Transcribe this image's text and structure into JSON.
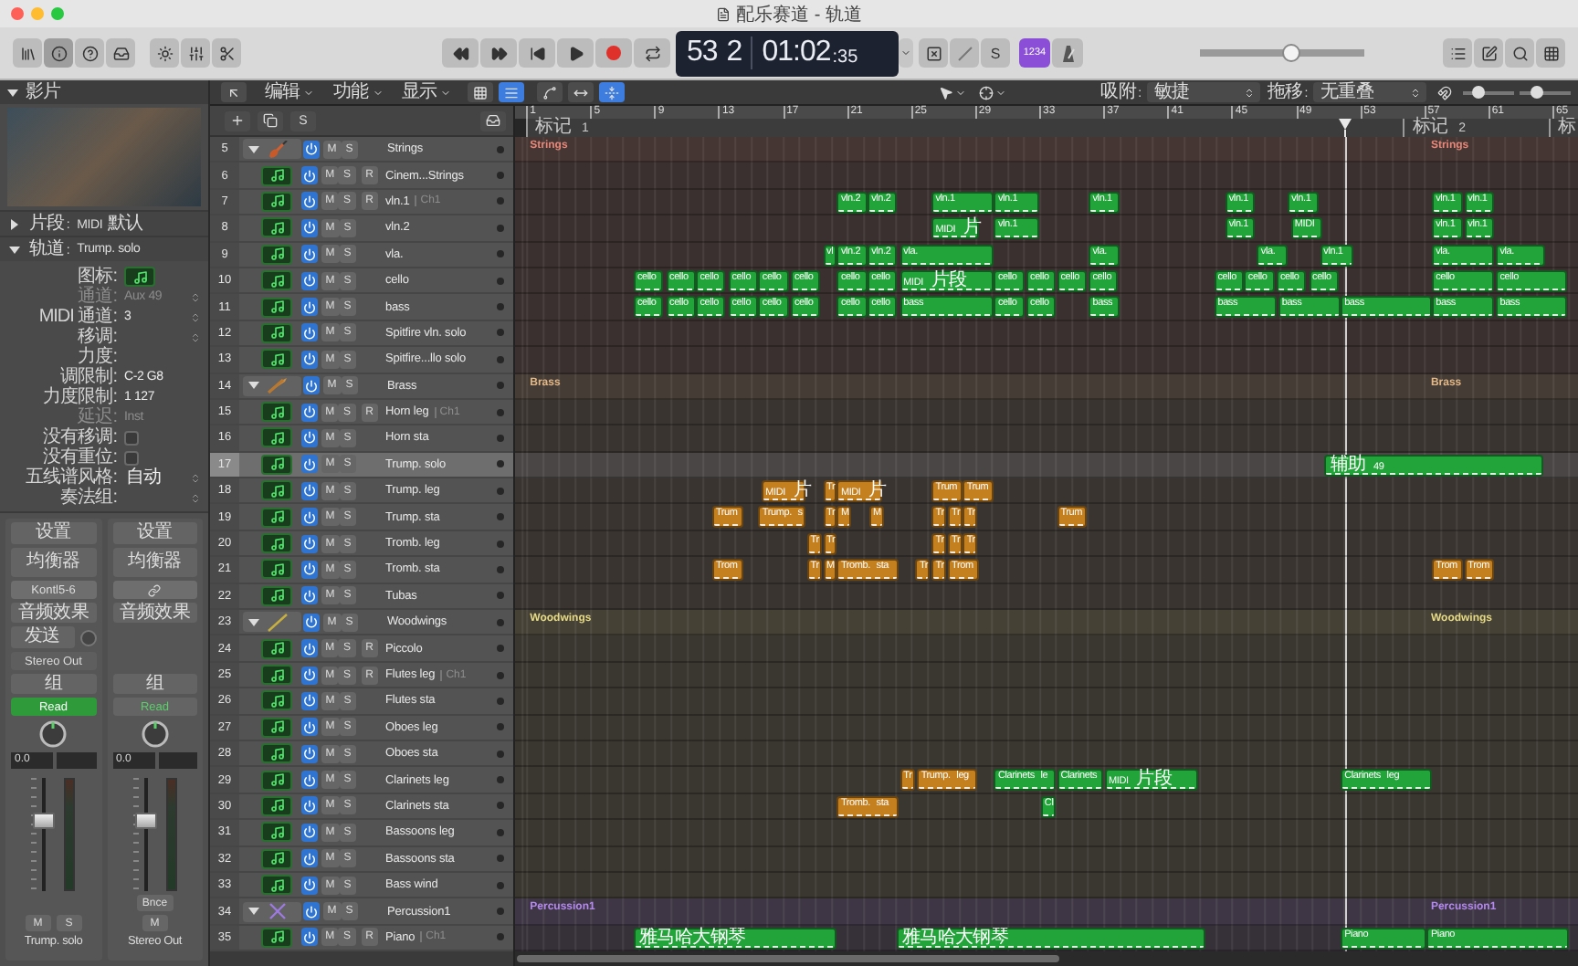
{
  "window": {
    "title": "配乐赛道 - 轨道"
  },
  "toolbar": {
    "lcd": {
      "bar": "53",
      "beat": "2",
      "time": "01:02",
      "time_fraction": ":35"
    },
    "solo_key": "S",
    "count_in": {
      "label": "1234",
      "on": true
    },
    "master_volume": {
      "level": 0.55
    }
  },
  "edit_bar": {
    "menus": [
      "编辑",
      "功能",
      "显示"
    ],
    "view_toggle": [
      {
        "selected": false
      },
      {
        "selected": true
      }
    ],
    "catch": {
      "on": true
    },
    "snap": {
      "label": "吸附:",
      "value": "敏捷"
    },
    "drag": {
      "label": "拖移:",
      "value": "无重叠"
    },
    "zoom": [
      {
        "level": 0.3
      },
      {
        "level": 0.35
      }
    ]
  },
  "track_header": {
    "solo_key": "S"
  },
  "inspector": {
    "title": "影片",
    "region": {
      "label": "片段:",
      "value": "MIDI 默认",
      "expanded": false
    },
    "track": {
      "label": "轨道:",
      "value": "Trump. solo",
      "expanded": true
    },
    "params": [
      {
        "kind": "icon",
        "label": "图标:"
      },
      {
        "kind": "menu",
        "label": "通道:",
        "value": "Aux 49",
        "disabled": true
      },
      {
        "kind": "menu",
        "label": "MIDI 通道:",
        "value": "3",
        "disabled": false
      },
      {
        "kind": "menu",
        "label": "移调:",
        "disabled": false
      },
      {
        "kind": "text",
        "label": "力度:",
        "disabled": false
      },
      {
        "kind": "text",
        "label": "调限制:",
        "value": "C-2 G8",
        "disabled": false
      },
      {
        "kind": "text",
        "label": "力度限制:",
        "value": "1 127",
        "disabled": false
      },
      {
        "kind": "text",
        "label": "延迟:",
        "value": "Inst",
        "disabled": true
      },
      {
        "kind": "checkbox",
        "label": "没有移调:",
        "checked": false
      },
      {
        "kind": "checkbox",
        "label": "没有重位:",
        "checked": false
      },
      {
        "kind": "menu",
        "label": "五线谱风格:",
        "value": "自动",
        "disabled": false
      },
      {
        "kind": "menu",
        "label": "奏法组:",
        "disabled": false
      }
    ],
    "strips": [
      {
        "setting": "设置",
        "eq": "均衡器",
        "slot": {
          "kind": "text",
          "label": "Kontl5-6"
        },
        "effects": "音频效果",
        "send": "发送",
        "output": "Stereo Out",
        "group": "组",
        "automation": {
          "label": "Read",
          "on": true
        },
        "pan": "0.0",
        "fader": {
          "level": 0.62
        },
        "buttons": [
          "M",
          "S"
        ],
        "name": "Trump. solo"
      },
      {
        "setting": "设置",
        "eq": "均衡器",
        "slot": {
          "kind": "link"
        },
        "effects": "音频效果",
        "group": "组",
        "automation": {
          "label": "Read",
          "on": false
        },
        "pan": "0.0",
        "fader": {
          "level": 0.62
        },
        "bounce": "Bnce",
        "buttons": [
          "M"
        ],
        "name": "Stereo Out"
      }
    ]
  },
  "ruler": {
    "bars": [
      "1",
      "5",
      "9",
      "13",
      "17",
      "21",
      "25",
      "29",
      "33",
      "37",
      "41",
      "45",
      "49",
      "53",
      "57",
      "61",
      "65"
    ],
    "markers": [
      "标记 1",
      "标记 2",
      "标"
    ]
  },
  "tracks": [
    {
      "number": "5",
      "kind": "folder",
      "name": "Strings",
      "expanded": true,
      "color": "#e7887a",
      "buttons": [
        "M",
        "S"
      ],
      "selected": false,
      "labels": [
        "Strings",
        "Strings"
      ]
    },
    {
      "number": "6",
      "kind": "track",
      "name": "Cinem...Strings",
      "buttons": [
        "M",
        "S",
        "R"
      ],
      "selected": false
    },
    {
      "number": "7",
      "kind": "track",
      "name": "vln.1",
      "tag": "Ch1",
      "buttons": [
        "M",
        "S",
        "R"
      ],
      "selected": false,
      "regions": [
        {
          "label": "vln.2",
          "color": "#22a43a"
        },
        {
          "label": "vln.2",
          "color": "#22a43a"
        },
        {
          "label": "vln.1",
          "color": "#22a43a"
        },
        {
          "label": "vln.1",
          "color": "#22a43a"
        },
        {
          "label": "vln.1",
          "color": "#22a43a"
        },
        {
          "label": "vln.1",
          "color": "#22a43a"
        },
        {
          "label": "vln.1",
          "color": "#22a43a"
        },
        {
          "label": "vln.1",
          "color": "#22a43a"
        },
        {
          "label": "vln.1",
          "color": "#22a43a"
        }
      ]
    },
    {
      "number": "8",
      "kind": "track",
      "name": "vln.2",
      "buttons": [
        "M",
        "S"
      ],
      "selected": false,
      "regions": [
        {
          "label": "MIDI 片",
          "color": "#22a43a"
        },
        {
          "label": "vln.1",
          "color": "#22a43a"
        },
        {
          "label": "vln.1",
          "color": "#22a43a"
        },
        {
          "label": "MIDI",
          "color": "#22a43a"
        },
        {
          "label": "vln.1",
          "color": "#22a43a"
        },
        {
          "label": "vln.1",
          "color": "#22a43a"
        }
      ]
    },
    {
      "number": "9",
      "kind": "track",
      "name": "vla.",
      "buttons": [
        "M",
        "S"
      ],
      "selected": false,
      "regions": [
        {
          "label": "vl",
          "color": "#22a43a"
        },
        {
          "label": "vln.2",
          "color": "#22a43a"
        },
        {
          "label": "vln.2",
          "color": "#22a43a"
        },
        {
          "label": "vla.",
          "color": "#22a43a"
        },
        {
          "label": "vla.",
          "color": "#22a43a"
        },
        {
          "label": "vla.",
          "color": "#22a43a"
        },
        {
          "label": "vln.1",
          "color": "#22a43a"
        },
        {
          "label": "vla.",
          "color": "#22a43a"
        },
        {
          "label": "vla.",
          "color": "#22a43a"
        }
      ]
    },
    {
      "number": "10",
      "kind": "track",
      "name": "cello",
      "buttons": [
        "M",
        "S"
      ],
      "selected": false,
      "regions": [
        {
          "label": "cello",
          "color": "#22a43a"
        },
        {
          "label": "cello",
          "color": "#22a43a"
        },
        {
          "label": "cello",
          "color": "#22a43a"
        },
        {
          "label": "cello",
          "color": "#22a43a"
        },
        {
          "label": "cello",
          "color": "#22a43a"
        },
        {
          "label": "cello",
          "color": "#22a43a"
        },
        {
          "label": "cello",
          "color": "#22a43a"
        },
        {
          "label": "cello",
          "color": "#22a43a"
        },
        {
          "label": "MIDI 片段",
          "color": "#22a43a"
        },
        {
          "label": "cello",
          "color": "#22a43a"
        },
        {
          "label": "cello",
          "color": "#22a43a"
        },
        {
          "label": "cello",
          "color": "#22a43a"
        },
        {
          "label": "cello",
          "color": "#22a43a"
        },
        {
          "label": "cello",
          "color": "#22a43a"
        },
        {
          "label": "cello",
          "color": "#22a43a"
        },
        {
          "label": "cello",
          "color": "#22a43a"
        },
        {
          "label": "cello",
          "color": "#22a43a"
        },
        {
          "label": "cello",
          "color": "#22a43a"
        },
        {
          "label": "cello",
          "color": "#22a43a"
        }
      ]
    },
    {
      "number": "11",
      "kind": "track",
      "name": "bass",
      "buttons": [
        "M",
        "S"
      ],
      "selected": false,
      "regions": [
        {
          "label": "cello",
          "color": "#22a43a"
        },
        {
          "label": "cello",
          "color": "#22a43a"
        },
        {
          "label": "cello",
          "color": "#22a43a"
        },
        {
          "label": "cello",
          "color": "#22a43a"
        },
        {
          "label": "cello",
          "color": "#22a43a"
        },
        {
          "label": "cello",
          "color": "#22a43a"
        },
        {
          "label": "cello",
          "color": "#22a43a"
        },
        {
          "label": "cello",
          "color": "#22a43a"
        },
        {
          "label": "bass",
          "color": "#22a43a"
        },
        {
          "label": "cello",
          "color": "#22a43a"
        },
        {
          "label": "cello",
          "color": "#22a43a"
        },
        {
          "label": "bass",
          "color": "#22a43a"
        },
        {
          "label": "bass",
          "color": "#22a43a"
        },
        {
          "label": "bass",
          "color": "#22a43a"
        },
        {
          "label": "bass",
          "color": "#22a43a"
        },
        {
          "label": "bass",
          "color": "#22a43a"
        },
        {
          "label": "bass",
          "color": "#22a43a"
        }
      ]
    },
    {
      "number": "12",
      "kind": "track",
      "name": "Spitfire vln. solo",
      "buttons": [
        "M",
        "S"
      ],
      "selected": false
    },
    {
      "number": "13",
      "kind": "track",
      "name": "Spitfire...llo solo",
      "buttons": [
        "M",
        "S"
      ],
      "selected": false
    },
    {
      "number": "14",
      "kind": "folder",
      "name": "Brass",
      "expanded": true,
      "color": "#e2b888",
      "buttons": [
        "M",
        "S"
      ],
      "selected": false,
      "labels": [
        "Brass",
        "Brass"
      ]
    },
    {
      "number": "15",
      "kind": "track",
      "name": "Horn leg",
      "tag": "Ch1",
      "buttons": [
        "M",
        "S",
        "R"
      ],
      "selected": false
    },
    {
      "number": "16",
      "kind": "track",
      "name": "Horn sta",
      "buttons": [
        "M",
        "S"
      ],
      "selected": false
    },
    {
      "number": "17",
      "kind": "track",
      "name": "Trump. solo",
      "buttons": [
        "M",
        "S"
      ],
      "selected": true,
      "regions": [
        {
          "label": "辅助 49",
          "color": "#22a43a"
        }
      ]
    },
    {
      "number": "18",
      "kind": "track",
      "name": "Trump. leg",
      "buttons": [
        "M",
        "S"
      ],
      "selected": false,
      "regions": [
        {
          "label": "MIDI 片",
          "color": "#c47f1f"
        },
        {
          "label": "Tr",
          "color": "#c47f1f"
        },
        {
          "label": "MIDI 片",
          "color": "#c47f1f"
        },
        {
          "label": "Trum",
          "color": "#c47f1f"
        },
        {
          "label": "Trum",
          "color": "#c47f1f"
        }
      ]
    },
    {
      "number": "19",
      "kind": "track",
      "name": "Trump. sta",
      "buttons": [
        "M",
        "S"
      ],
      "selected": false,
      "regions": [
        {
          "label": "Trum",
          "color": "#c47f1f"
        },
        {
          "label": "Trump. s",
          "color": "#c47f1f"
        },
        {
          "label": "Tr",
          "color": "#c47f1f"
        },
        {
          "label": "M",
          "color": "#c47f1f"
        },
        {
          "label": "M",
          "color": "#c47f1f"
        },
        {
          "label": "Tr",
          "color": "#c47f1f"
        },
        {
          "label": "Tr",
          "color": "#c47f1f"
        },
        {
          "label": "Tr",
          "color": "#c47f1f"
        },
        {
          "label": "Trum",
          "color": "#c47f1f"
        }
      ]
    },
    {
      "number": "20",
      "kind": "track",
      "name": "Tromb. leg",
      "buttons": [
        "M",
        "S"
      ],
      "selected": false,
      "regions": [
        {
          "label": "Tr",
          "color": "#c47f1f"
        },
        {
          "label": "Tr",
          "color": "#c47f1f"
        },
        {
          "label": "Tr",
          "color": "#c47f1f"
        },
        {
          "label": "Tr",
          "color": "#c47f1f"
        },
        {
          "label": "Tr",
          "color": "#c47f1f"
        }
      ]
    },
    {
      "number": "21",
      "kind": "track",
      "name": "Tromb. sta",
      "buttons": [
        "M",
        "S"
      ],
      "selected": false,
      "regions": [
        {
          "label": "Trom",
          "color": "#c47f1f"
        },
        {
          "label": "Tr",
          "color": "#c47f1f"
        },
        {
          "label": "M",
          "color": "#c47f1f"
        },
        {
          "label": "Tromb. sta",
          "color": "#c47f1f"
        },
        {
          "label": "Tr",
          "color": "#c47f1f"
        },
        {
          "label": "Tr",
          "color": "#c47f1f"
        },
        {
          "label": "Trom",
          "color": "#c47f1f"
        },
        {
          "label": "Trom",
          "color": "#c47f1f"
        },
        {
          "label": "Trom",
          "color": "#c47f1f"
        }
      ]
    },
    {
      "number": "22",
      "kind": "track",
      "name": "Tubas",
      "buttons": [
        "M",
        "S"
      ],
      "selected": false
    },
    {
      "number": "23",
      "kind": "folder",
      "name": "Woodwings",
      "expanded": true,
      "color": "#e6da86",
      "buttons": [
        "M",
        "S"
      ],
      "selected": false,
      "labels": [
        "Woodwings",
        "Woodwings"
      ]
    },
    {
      "number": "24",
      "kind": "track",
      "name": "Piccolo",
      "buttons": [
        "M",
        "S",
        "R"
      ],
      "selected": false
    },
    {
      "number": "25",
      "kind": "track",
      "name": "Flutes leg",
      "tag": "Ch1",
      "buttons": [
        "M",
        "S",
        "R"
      ],
      "selected": false
    },
    {
      "number": "26",
      "kind": "track",
      "name": "Flutes sta",
      "buttons": [
        "M",
        "S"
      ],
      "selected": false
    },
    {
      "number": "27",
      "kind": "track",
      "name": "Oboes leg",
      "buttons": [
        "M",
        "S"
      ],
      "selected": false
    },
    {
      "number": "28",
      "kind": "track",
      "name": "Oboes sta",
      "buttons": [
        "M",
        "S"
      ],
      "selected": false
    },
    {
      "number": "29",
      "kind": "track",
      "name": "Clarinets leg",
      "buttons": [
        "M",
        "S"
      ],
      "selected": false,
      "regions": [
        {
          "label": "Tr",
          "color": "#c47f1f"
        },
        {
          "label": "Trump. leg",
          "color": "#c47f1f"
        },
        {
          "label": "Clarinets le",
          "color": "#22a43a"
        },
        {
          "label": "Clarinets",
          "color": "#22a43a"
        },
        {
          "label": "MIDI 片段",
          "color": "#22a43a"
        },
        {
          "label": "Clarinets leg",
          "color": "#22a43a"
        }
      ]
    },
    {
      "number": "30",
      "kind": "track",
      "name": "Clarinets sta",
      "buttons": [
        "M",
        "S"
      ],
      "selected": false,
      "regions": [
        {
          "label": "Tromb. sta",
          "color": "#c47f1f"
        },
        {
          "label": "Cl",
          "color": "#22a43a"
        }
      ]
    },
    {
      "number": "31",
      "kind": "track",
      "name": "Bassoons leg",
      "buttons": [
        "M",
        "S"
      ],
      "selected": false
    },
    {
      "number": "32",
      "kind": "track",
      "name": "Bassoons sta",
      "buttons": [
        "M",
        "S"
      ],
      "selected": false
    },
    {
      "number": "33",
      "kind": "track",
      "name": "Bass wind",
      "buttons": [
        "M",
        "S"
      ],
      "selected": false
    },
    {
      "number": "34",
      "kind": "folder",
      "name": "Percussion1",
      "expanded": true,
      "color": "#b58aef",
      "buttons": [
        "M",
        "S"
      ],
      "selected": false,
      "labels": [
        "Percussion1",
        "Percussion1"
      ]
    },
    {
      "number": "35",
      "kind": "track",
      "name": "Piano",
      "tag": "Ch1",
      "buttons": [
        "M",
        "S",
        "R"
      ],
      "selected": false,
      "regions": [
        {
          "label": "雅马哈大钢琴",
          "color": "#22a43a"
        },
        {
          "label": "雅马哈大钢琴",
          "color": "#22a43a"
        },
        {
          "label": "Piano",
          "color": "#22a43a"
        },
        {
          "label": "Piano",
          "color": "#22a43a"
        }
      ]
    }
  ]
}
